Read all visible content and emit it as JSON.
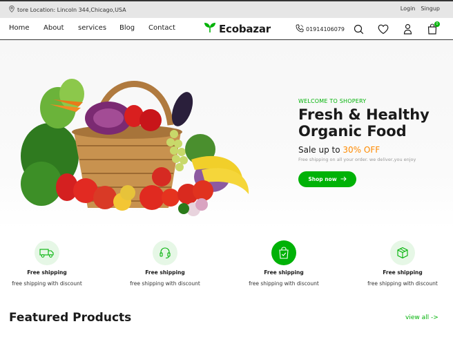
{
  "topbar": {
    "location_icon": "location-pin-icon",
    "location": "tore Location: Lincoln 344,Chicago,USA",
    "login": "Login",
    "signup": "Singup"
  },
  "nav": {
    "links": [
      "Home",
      "About",
      "services",
      "Blog",
      "Contact"
    ],
    "logo_icon": "leaf-icon",
    "logo_text": "Ecobazar",
    "phone_icon": "phone-icon",
    "phone": "01914106079",
    "icons": [
      "search-icon",
      "heart-icon",
      "user-icon",
      "bag-icon"
    ],
    "cart_count": "0"
  },
  "hero": {
    "image": "vegetable-basket-image",
    "eyebrow": "WELCOME TO SHOPERY",
    "headline_line1": "Fresh & Healthy",
    "headline_line2": "Organic Food",
    "sale_prefix": "Sale up to ",
    "sale_percent": "30% OFF",
    "subtext": "Free shipping on all your order. we deliver,you enjoy",
    "cta_label": "Shop now",
    "cta_icon": "arrow-right-icon"
  },
  "features": [
    {
      "icon": "truck-icon",
      "title": "Free shipping",
      "desc": "free shipping with discount"
    },
    {
      "icon": "headset-icon",
      "title": "Free shipping",
      "desc": "free shipping with discount"
    },
    {
      "icon": "shopping-bag-check-icon",
      "title": "Free shipping",
      "desc": "free shipping with discount"
    },
    {
      "icon": "package-icon",
      "title": "Free shipping",
      "desc": "free shipping with discount"
    }
  ],
  "featured": {
    "title": "Featured Products",
    "view_all": "view all ->"
  },
  "colors": {
    "accent": "#00b207",
    "sale": "#ff8a00",
    "topbar_bg": "#e6e6e6"
  }
}
